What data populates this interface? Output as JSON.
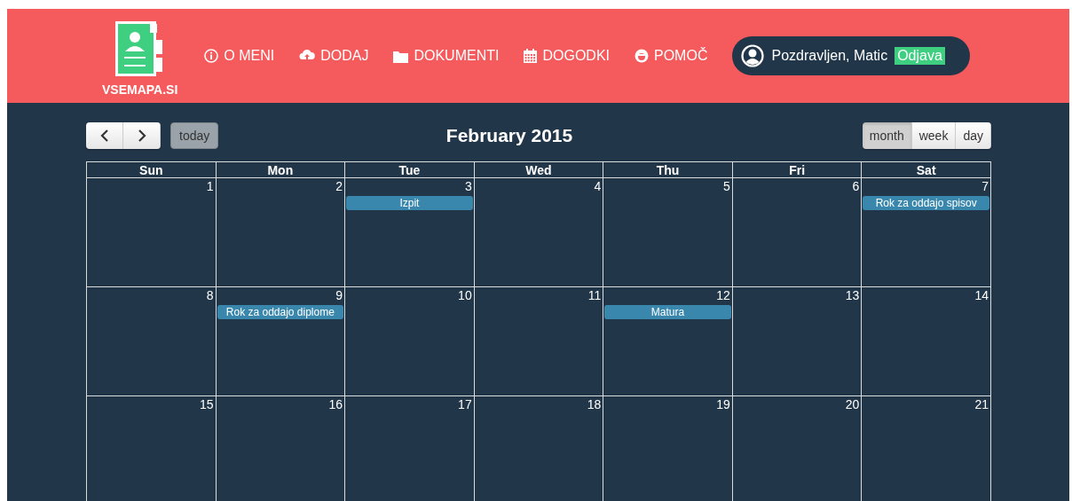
{
  "logo": {
    "name": "VSEMAPA.SI"
  },
  "nav": [
    {
      "label": "O MENI",
      "kind": "info"
    },
    {
      "label": "DODAJ",
      "kind": "upload"
    },
    {
      "label": "DOKUMENTI",
      "kind": "folder"
    },
    {
      "label": "DOGODKI",
      "kind": "calendar"
    },
    {
      "label": "POMOČ",
      "kind": "help"
    }
  ],
  "user": {
    "greeting": "Pozdravljen, Matic",
    "logout": "Odjava"
  },
  "calendar": {
    "title": "February 2015",
    "today": "today",
    "views": [
      {
        "label": "month",
        "selected": true
      },
      {
        "label": "week",
        "selected": false
      },
      {
        "label": "day",
        "selected": false
      }
    ],
    "weekdays": [
      "Sun",
      "Mon",
      "Tue",
      "Wed",
      "Thu",
      "Fri",
      "Sat"
    ],
    "weeks": [
      {
        "days": [
          {
            "number": "1"
          },
          {
            "number": "2"
          },
          {
            "number": "3",
            "events": [
              "Izpit"
            ]
          },
          {
            "number": "4"
          },
          {
            "number": "5"
          },
          {
            "number": "6"
          },
          {
            "number": "7",
            "events": [
              "Rok za oddajo spisov"
            ]
          }
        ]
      },
      {
        "days": [
          {
            "number": "8"
          },
          {
            "number": "9",
            "events": [
              "Rok za oddajo diplome"
            ]
          },
          {
            "number": "10"
          },
          {
            "number": "11"
          },
          {
            "number": "12",
            "events": [
              "Matura"
            ]
          },
          {
            "number": "13"
          },
          {
            "number": "14"
          }
        ]
      },
      {
        "days": [
          {
            "number": "15"
          },
          {
            "number": "16"
          },
          {
            "number": "17"
          },
          {
            "number": "18"
          },
          {
            "number": "19"
          },
          {
            "number": "20"
          },
          {
            "number": "21"
          }
        ]
      }
    ]
  }
}
